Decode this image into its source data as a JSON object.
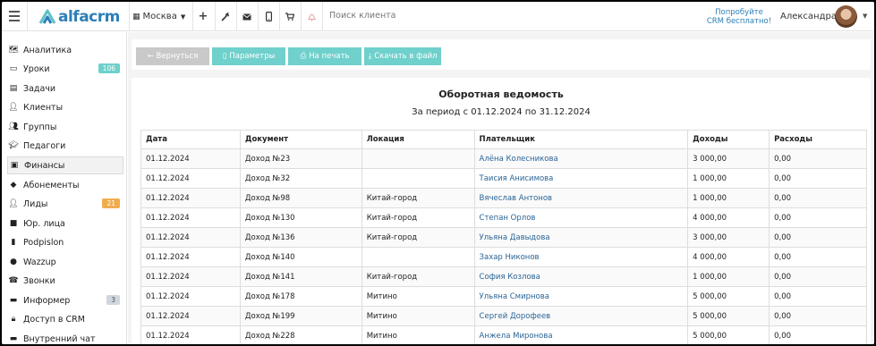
{
  "header": {
    "logo_text": "alfacrm",
    "city": "Москва",
    "search_placeholder": "Поиск клиента",
    "promo_line1": "Попробуйте",
    "promo_line2": "CRM бесплатно!",
    "user_name": "Александра",
    "icons": [
      "add-icon",
      "wrench-icon",
      "mail-icon",
      "phone-icon",
      "cart-icon",
      "bell-icon"
    ]
  },
  "sidebar": {
    "items": [
      {
        "label": "Аналитика",
        "icon": "map-icon"
      },
      {
        "label": "Уроки",
        "icon": "calendar-icon",
        "badge": "106",
        "badge_color": "#6fd0cc"
      },
      {
        "label": "Задачи",
        "icon": "tasks-icon"
      },
      {
        "label": "Клиенты",
        "icon": "user-icon"
      },
      {
        "label": "Группы",
        "icon": "users-icon"
      },
      {
        "label": "Педагоги",
        "icon": "graduation-cap-icon"
      },
      {
        "label": "Финансы",
        "icon": "money-icon",
        "active": true
      },
      {
        "label": "Абонементы",
        "icon": "tag-icon"
      },
      {
        "label": "Лиды",
        "icon": "add-user-icon",
        "badge": "21",
        "badge_color": "#f0ad4e"
      },
      {
        "label": "Юр. лица",
        "icon": "briefcase-icon"
      },
      {
        "label": "Podpislon",
        "icon": "document-icon"
      },
      {
        "label": "Wazzup",
        "icon": "whatsapp-icon"
      },
      {
        "label": "Звонки",
        "icon": "phone-icon"
      },
      {
        "label": "Информер",
        "icon": "informer-icon",
        "badge": "3",
        "badge_color": "#cfd6de"
      },
      {
        "label": "Доступ в CRM",
        "icon": "lock-icon"
      },
      {
        "label": "Внутренний чат",
        "icon": "chat-icon"
      }
    ]
  },
  "toolbar": {
    "back_label": "← Вернуться",
    "params_label": "Параметры",
    "print_label": "На печать",
    "download_label": "Скачать в файл"
  },
  "report": {
    "title": "Оборотная ведомость",
    "subtitle": "За период с 01.12.2024 по 31.12.2024",
    "columns": [
      "Дата",
      "Документ",
      "Локация",
      "Плательщик",
      "Доходы",
      "Расходы"
    ],
    "rows": [
      [
        "01.12.2024",
        "Доход №23",
        "",
        "Алёна Колесникова",
        "3 000,00",
        "0,00"
      ],
      [
        "01.12.2024",
        "Доход №32",
        "",
        "Таисия Анисимова",
        "1 000,00",
        "0,00"
      ],
      [
        "01.12.2024",
        "Доход №98",
        "Китай-город",
        "Вячеслав Антонов",
        "1 000,00",
        "0,00"
      ],
      [
        "01.12.2024",
        "Доход №130",
        "Китай-город",
        "Степан Орлов",
        "4 000,00",
        "0,00"
      ],
      [
        "01.12.2024",
        "Доход №136",
        "Китай-город",
        "Ульяна Давыдова",
        "3 000,00",
        "0,00"
      ],
      [
        "01.12.2024",
        "Доход №140",
        "",
        "Захар Никонов",
        "4 000,00",
        "0,00"
      ],
      [
        "01.12.2024",
        "Доход №141",
        "Китай-город",
        "София Козлова",
        "1 000,00",
        "0,00"
      ],
      [
        "01.12.2024",
        "Доход №178",
        "Митино",
        "Ульяна Смирнова",
        "5 000,00",
        "0,00"
      ],
      [
        "01.12.2024",
        "Доход №199",
        "Митино",
        "Сергей Дорофеев",
        "5 000,00",
        "0,00"
      ],
      [
        "01.12.2024",
        "Доход №228",
        "Митино",
        "Анжела Миронова",
        "5 000,00",
        "0,00"
      ]
    ]
  }
}
